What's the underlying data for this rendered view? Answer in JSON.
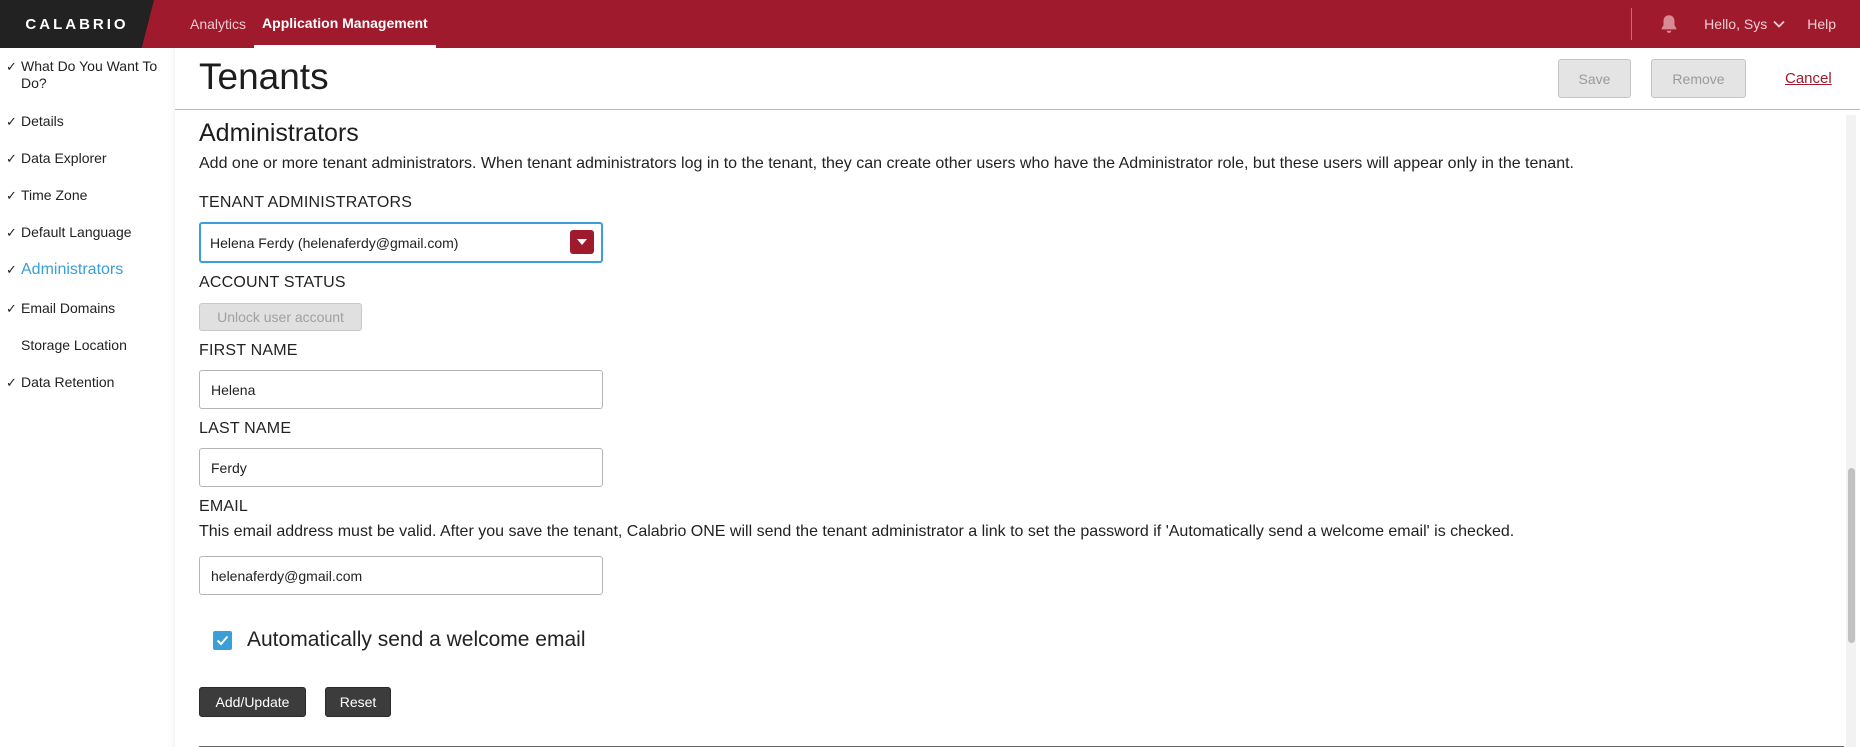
{
  "topbar": {
    "logo": "CALABRIO",
    "nav": [
      "Analytics",
      "Application Management"
    ],
    "greeting": "Hello, Sys",
    "help": "Help"
  },
  "sidebar": {
    "items": [
      {
        "label": "What Do You Want To Do?",
        "checked": true
      },
      {
        "label": "Details",
        "checked": true
      },
      {
        "label": "Data Explorer",
        "checked": true
      },
      {
        "label": "Time Zone",
        "checked": true
      },
      {
        "label": "Default Language",
        "checked": true
      },
      {
        "label": "Administrators",
        "checked": true,
        "active": true
      },
      {
        "label": "Email Domains",
        "checked": true
      },
      {
        "label": "Storage Location",
        "checked": false
      },
      {
        "label": "Data Retention",
        "checked": true
      }
    ],
    "check_glyph": "✓"
  },
  "header": {
    "title": "Tenants",
    "save": "Save",
    "remove": "Remove",
    "cancel": "Cancel"
  },
  "administrators": {
    "title": "Administrators",
    "description": "Add one or more tenant administrators. When tenant administrators log in to the tenant, they can create other users who have the Administrator role, but these users will appear only in the tenant.",
    "tenant_admins_label": "TENANT ADMINISTRATORS",
    "selected_admin": "Helena Ferdy (helenaferdy@gmail.com)",
    "account_status_label": "ACCOUNT STATUS",
    "unlock_button": "Unlock user account",
    "first_name_label": "FIRST NAME",
    "first_name": "Helena",
    "last_name_label": "LAST NAME",
    "last_name": "Ferdy",
    "email_label": "EMAIL",
    "email_description": "This email address must be valid. After you save the tenant, Calabrio ONE will send the tenant administrator a link to set the password if 'Automatically send a welcome email' is checked.",
    "email": "helenaferdy@gmail.com",
    "welcome_email_label": "Automatically send a welcome email",
    "welcome_email_checked": true,
    "add_update_button": "Add/Update",
    "reset_button": "Reset"
  },
  "colors": {
    "brand": "#9e1a2c",
    "accent": "#3a9fd8"
  }
}
